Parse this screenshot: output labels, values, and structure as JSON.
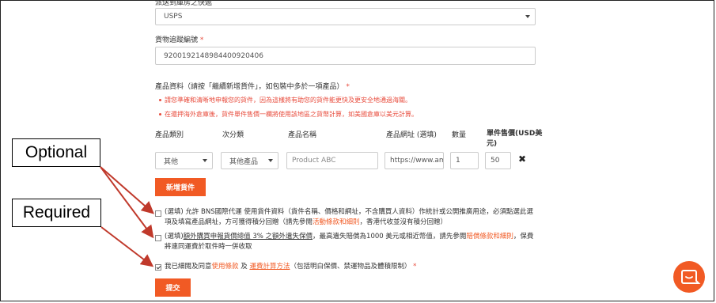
{
  "carrier": {
    "label": "派送到庫房之快遞",
    "value": "USPS"
  },
  "tracking": {
    "label": "貨物追蹤編號",
    "required_mark": "*",
    "value": "9200192148984400920406"
  },
  "products": {
    "label": "產品資料（請按「繼續新增貨件」，如包裝中多於一項產品）",
    "required_mark": "*",
    "notes": [
      "請您準確和清晰地申報您的貨件，因為這樣將有助您的貨件能更快及更安全地通過海關。",
      "在還押海外倉庫後，貨件單件售價一欄將使用該地區之貨幣計算，如美國倉庫以美元計算。"
    ],
    "columns": {
      "category": "產品類別",
      "subcategory": "次分類",
      "name": "產品名稱",
      "url": "產品網址 (選填)",
      "quantity": "數量",
      "price": "單件售價(USD美元)"
    },
    "row": {
      "category": "其他",
      "subcategory": "其他產品",
      "name_placeholder": "Product ABC",
      "url_value": "https://www.ama",
      "quantity": "1",
      "price": "50",
      "remove": "✖"
    },
    "add_button": "新增貨件"
  },
  "options": [
    {
      "checked": false,
      "text_before": "(選填) 允許 BNS國際代運 使用貨件資料（貨件名稱、價格和網址，不含購買人資料）作統計或公開推廣用途，必須點選此選項及填寫產品網址，方可獲得積分回贈（請先參閱",
      "link": "活動條款和細則",
      "text_after": "，香港代收並沒有積分回贈）"
    },
    {
      "checked": false,
      "text_before": "(選填)",
      "underlined": "額外購買申報貨價總值 3% 之額外遺失保價",
      "text_mid": "，最高遺失賠償為1000 美元或相近幣值，請先參閱",
      "link": "賠償條款和細則",
      "text_after": "，保費將連同運費於取件時一併收取"
    },
    {
      "checked": true,
      "text_before": "我已細閱及同意",
      "link1": "使用條款",
      "text_mid": " 及 ",
      "link2": "運費計算方法",
      "text_after": "（包括明白保價、禁運物品及體積限制）",
      "required_mark": "*"
    }
  ],
  "submit_button": "提交",
  "annotations": {
    "optional": "Optional",
    "required": "Required"
  },
  "colors": {
    "accent": "#f15a24",
    "required": "#e84c3d"
  },
  "icons": {
    "chat": "chat-bubble-icon"
  }
}
